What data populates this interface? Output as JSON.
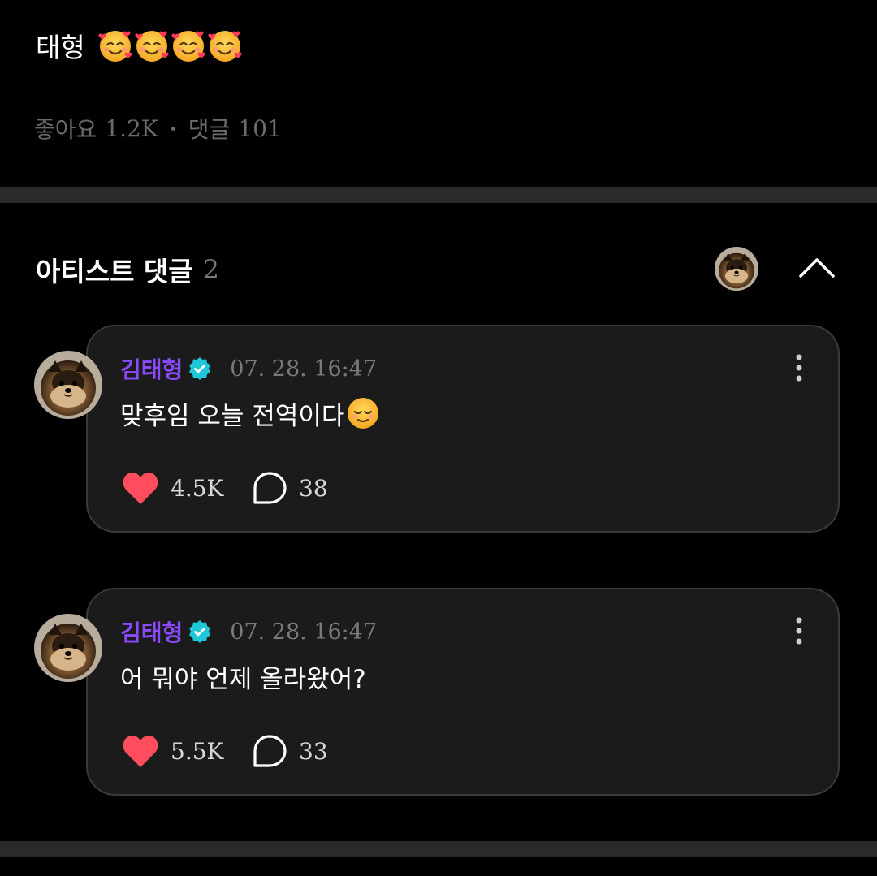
{
  "post": {
    "text": "태형",
    "emoji_icons": [
      "smiling-face-with-hearts-icon",
      "smiling-face-with-hearts-icon",
      "smiling-face-with-hearts-icon",
      "smiling-face-with-hearts-icon"
    ],
    "likes_label": "좋아요",
    "likes_count": "1.2K",
    "comments_label": "댓글",
    "comments_count": "101"
  },
  "artist_comments": {
    "title": "아티스트 댓글",
    "count": "2",
    "avatar_icon": "pomeranian-avatar",
    "collapse_icon": "chevron-up-icon"
  },
  "comments": [
    {
      "author": "김태형",
      "verified_icon": "verified-badge-icon",
      "timestamp": "07. 28. 16:47",
      "text": "맞후임 오늘 전역이다",
      "text_emoji": "relieved-face-icon",
      "likes": "4.5K",
      "replies": "38"
    },
    {
      "author": "김태형",
      "verified_icon": "verified-badge-icon",
      "timestamp": "07. 28. 16:47",
      "text": "어 뭐야 언제 올라왔어?",
      "likes": "5.5K",
      "replies": "33"
    }
  ],
  "colors": {
    "background": "#000000",
    "card": "#1b1b1b",
    "card_border": "#3a3a3a",
    "author": "#8a4bff",
    "verified": "#1ec8d8",
    "heart": "#ff4d5e",
    "muted": "#7a7a7a",
    "divider": "#2a2a2a"
  }
}
